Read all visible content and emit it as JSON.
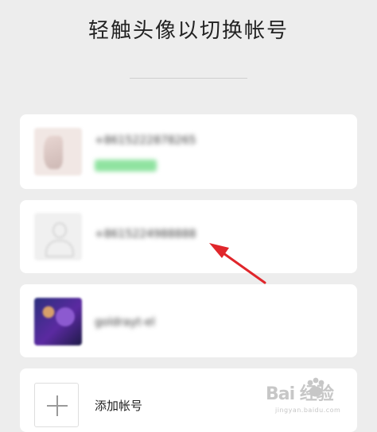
{
  "header": {
    "title": "轻触头像以切换帐号"
  },
  "accounts": [
    {
      "label": "+8615222878265"
    },
    {
      "label": "+8615224988888"
    },
    {
      "label": "goldrayt-el"
    }
  ],
  "add_account": {
    "label": "添加帐号"
  },
  "watermark": {
    "brand": "Bai 经验",
    "url": "jingyan.baidu.com"
  },
  "colors": {
    "accent_arrow": "#e0262b",
    "status_green": "#8fe3a0",
    "background": "#ededed"
  }
}
